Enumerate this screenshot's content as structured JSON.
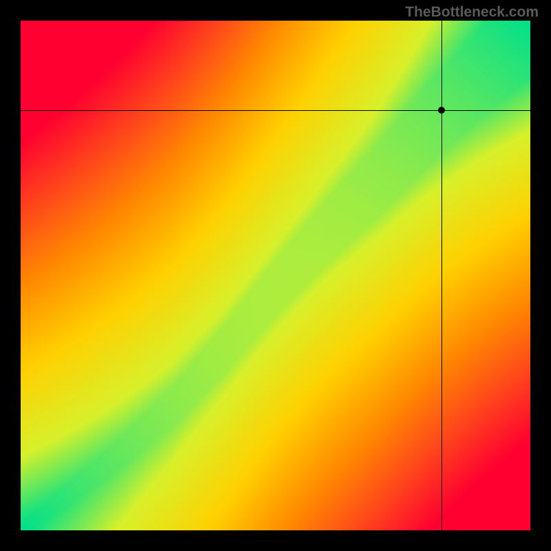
{
  "watermark": "TheBottleneck.com",
  "chart_data": {
    "type": "heatmap",
    "title": "",
    "xlabel": "",
    "ylabel": "",
    "xlim": [
      0,
      1
    ],
    "ylim": [
      0,
      1
    ],
    "crosshair": {
      "x": 0.825,
      "y": 0.825
    },
    "point": {
      "x": 0.825,
      "y": 0.825
    },
    "ridge_description": "Diagonal green optimum band from lower-left to upper-right with slight S-curve; value falls off to yellow then red away from the ridge. Upper-left and lower-right corners are most red.",
    "color_stops": [
      {
        "t": 0.0,
        "color": "#00e08a"
      },
      {
        "t": 0.18,
        "color": "#d8f02a"
      },
      {
        "t": 0.4,
        "color": "#ffd000"
      },
      {
        "t": 0.62,
        "color": "#ff8a00"
      },
      {
        "t": 0.8,
        "color": "#ff4a1a"
      },
      {
        "t": 1.0,
        "color": "#ff0030"
      }
    ],
    "ridge_samples": [
      {
        "x": 0.0,
        "y": 0.0
      },
      {
        "x": 0.1,
        "y": 0.075
      },
      {
        "x": 0.2,
        "y": 0.155
      },
      {
        "x": 0.3,
        "y": 0.245
      },
      {
        "x": 0.4,
        "y": 0.355
      },
      {
        "x": 0.5,
        "y": 0.475
      },
      {
        "x": 0.6,
        "y": 0.585
      },
      {
        "x": 0.7,
        "y": 0.685
      },
      {
        "x": 0.8,
        "y": 0.795
      },
      {
        "x": 0.9,
        "y": 0.895
      },
      {
        "x": 1.0,
        "y": 0.985
      }
    ],
    "ridge_halfwidth": {
      "at0": 0.012,
      "at1": 0.095
    }
  }
}
